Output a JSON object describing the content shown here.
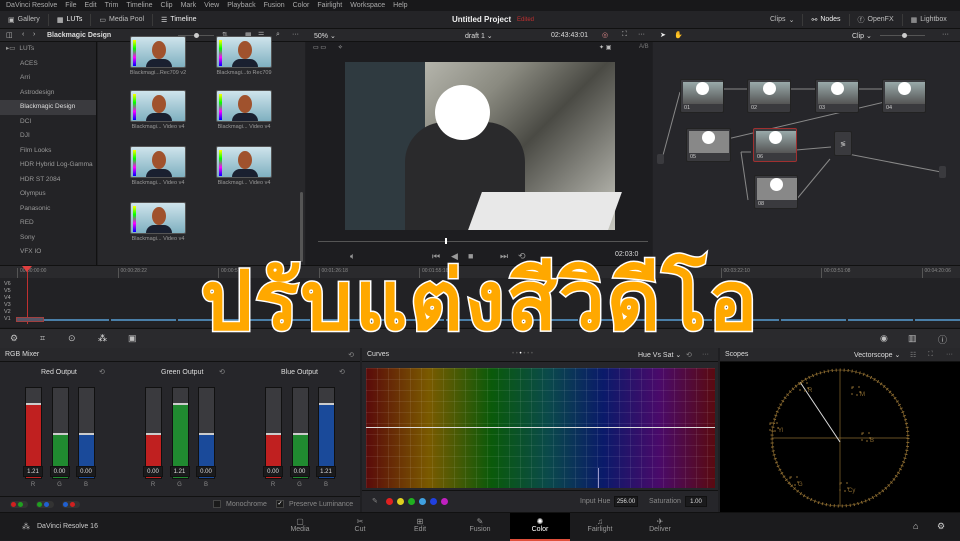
{
  "menu": [
    "DaVinci Resolve",
    "File",
    "Edit",
    "Trim",
    "Timeline",
    "Clip",
    "Mark",
    "View",
    "Playback",
    "Fusion",
    "Color",
    "Fairlight",
    "Workspace",
    "Help"
  ],
  "toolbar": {
    "gallery": "Gallery",
    "luts": "LUTs",
    "media_pool": "Media Pool",
    "timeline": "Timeline",
    "project_title": "Untitled Project",
    "project_status": "Edited",
    "clips": "Clips",
    "nodes": "Nodes",
    "openfx": "OpenFX",
    "lightbox": "Lightbox"
  },
  "row2": {
    "breadcrumb": "Blackmagic Design",
    "zoom": "50%",
    "timeline_name": "draft 1",
    "timecode": "02:43:43:01",
    "node_mode": "Clip",
    "ab": "A/B"
  },
  "lut_folders": [
    "LUTs",
    "ACES",
    "Arri",
    "Astrodesign",
    "Blackmagic Design",
    "DCI",
    "DJI",
    "Film Looks",
    "HDR Hybrid Log-Gamma",
    "HDR ST 2084",
    "Olympus",
    "Panasonic",
    "RED",
    "Sony",
    "VFX IO"
  ],
  "lut_items": [
    "Blackmagi...Rec709 v2",
    "Blackmagi...to Rec709",
    "Blackmagi... Video v4",
    "Blackmagi... Video v4",
    "Blackmagi... Video v4",
    "Blackmagi... Video v4",
    "Blackmagi... Video v4"
  ],
  "viewer": {
    "timecode": "02:03:0"
  },
  "nodes": [
    "01",
    "02",
    "03",
    "04",
    "05",
    "06",
    "08"
  ],
  "timeline": {
    "ticks": [
      "00:00:00:00",
      "00:00:28:22",
      "00:00:57:20",
      "00:01:26:18",
      "00:01:55:16",
      "00:02:24:14",
      "00:02:53:12",
      "00:03:22:10",
      "00:03:51:08",
      "00:04:20:06"
    ],
    "tracks": [
      "V6",
      "V5",
      "V4",
      "V3",
      "V2",
      "V1"
    ]
  },
  "rgb_mixer": {
    "title": "RGB Mixer",
    "groups": [
      {
        "label": "Red Output",
        "values": [
          "1.21",
          "0.00",
          "0.00"
        ],
        "levels": [
          0.83,
          0.5,
          0.5
        ]
      },
      {
        "label": "Green Output",
        "values": [
          "0.00",
          "1.21",
          "0.00"
        ],
        "levels": [
          0.5,
          0.83,
          0.5
        ]
      },
      {
        "label": "Blue Output",
        "values": [
          "0.00",
          "0.00",
          "1.21"
        ],
        "levels": [
          0.5,
          0.5,
          0.83
        ]
      }
    ],
    "channels": [
      "R",
      "G",
      "B"
    ],
    "monochrome": "Monochrome",
    "monochrome_checked": false,
    "preserve": "Preserve Luminance",
    "preserve_checked": true
  },
  "curves": {
    "title": "Curves",
    "mode": "Hue Vs Sat",
    "input_hue_label": "Input Hue",
    "input_hue": "256.00",
    "saturation_label": "Saturation",
    "saturation": "1.00",
    "swatches": [
      "#e02020",
      "#e0d020",
      "#20b020",
      "#40a0e0",
      "#2040e0",
      "#c020c0"
    ]
  },
  "scopes": {
    "title": "Scopes",
    "mode": "Vectorscope",
    "targets": [
      "R",
      "M",
      "Yl",
      "B",
      "G",
      "Cy"
    ]
  },
  "pages": [
    "Media",
    "Cut",
    "Edit",
    "Fusion",
    "Color",
    "Fairlight",
    "Deliver"
  ],
  "active_page": "Color",
  "app_name": "DaVinci Resolve 16",
  "overlay_title": "ปรับแต่งสีวิดีโอ"
}
